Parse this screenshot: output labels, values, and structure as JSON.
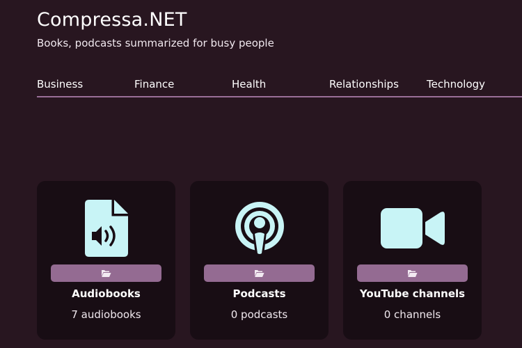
{
  "header": {
    "title": "Compressa.NET",
    "tagline": "Books, podcasts summarized for busy people"
  },
  "nav": {
    "items": [
      "Business",
      "Finance",
      "Health",
      "Relationships",
      "Technology"
    ]
  },
  "cards": [
    {
      "title": "Audiobooks",
      "count": "7 audiobooks",
      "icon": "audio-file-icon"
    },
    {
      "title": "Podcasts",
      "count": "0 podcasts",
      "icon": "podcast-icon"
    },
    {
      "title": "YouTube channels",
      "count": "0 channels",
      "icon": "video-camera-icon"
    }
  ],
  "colors": {
    "background": "#281620",
    "card": "#180d14",
    "accent": "#946b92",
    "icon": "#c8f4f6"
  }
}
